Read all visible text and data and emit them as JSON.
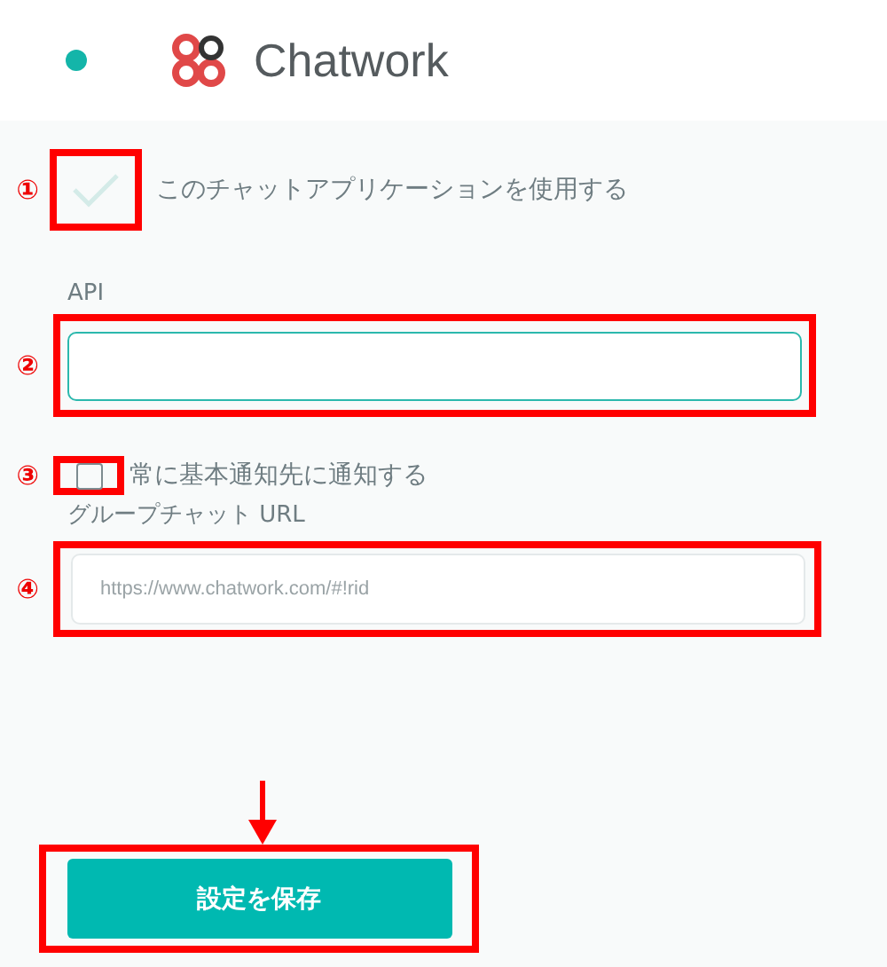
{
  "header": {
    "title": "Chatwork"
  },
  "use_app": {
    "marker": "①",
    "checked": true,
    "label": "このチャットアプリケーションを使用する"
  },
  "api": {
    "label": "API",
    "marker": "②",
    "focused": true
  },
  "notify_default": {
    "marker": "③",
    "checked": false,
    "label": "常に基本通知先に通知する"
  },
  "group_url": {
    "label": "グループチャット URL",
    "marker": "④",
    "placeholder": "https://www.chatwork.com/#!rid"
  },
  "save_button": {
    "label": "設定を保存"
  }
}
